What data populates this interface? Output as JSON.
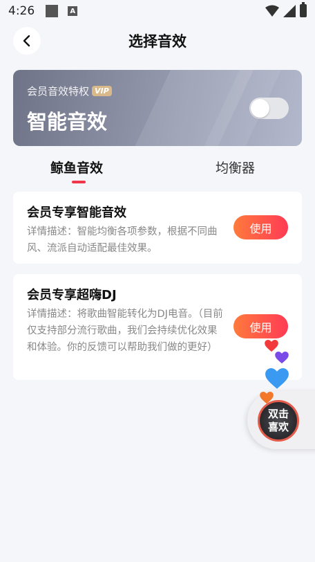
{
  "status_bar": {
    "time": "4:26",
    "notif_icon_text": "A"
  },
  "header": {
    "title": "选择音效"
  },
  "vip_card": {
    "subtitle": "会员音效特权",
    "badge": "VIP",
    "title": "智能音效",
    "toggle_on": false
  },
  "tabs": [
    {
      "label": "鲸鱼音效",
      "active": true
    },
    {
      "label": "均衡器",
      "active": false
    }
  ],
  "effects": [
    {
      "name": "会员专享智能音效",
      "description": "详情描述：智能均衡各项参数，根据不同曲风、流派自动适配最佳效果。",
      "button_label": "使用"
    },
    {
      "name": "会员专享超嗨DJ",
      "description": "详情描述：将歌曲智能转化为DJ电音。（目前仅支持部分流行歌曲，我们会持续优化效果和体验。你的反馈可以帮助我们做的更好）",
      "button_label": "使用"
    }
  ],
  "float_like": {
    "line1": "双击",
    "line2": "喜欢"
  },
  "colors": {
    "accent": "#f2364a",
    "button_gradient_start": "#ff7a3c",
    "button_gradient_end": "#ff3b55",
    "heart_red": "#f23a3a",
    "heart_purple": "#7b4be8",
    "heart_blue": "#3a9af2",
    "heart_orange": "#f2772a"
  }
}
